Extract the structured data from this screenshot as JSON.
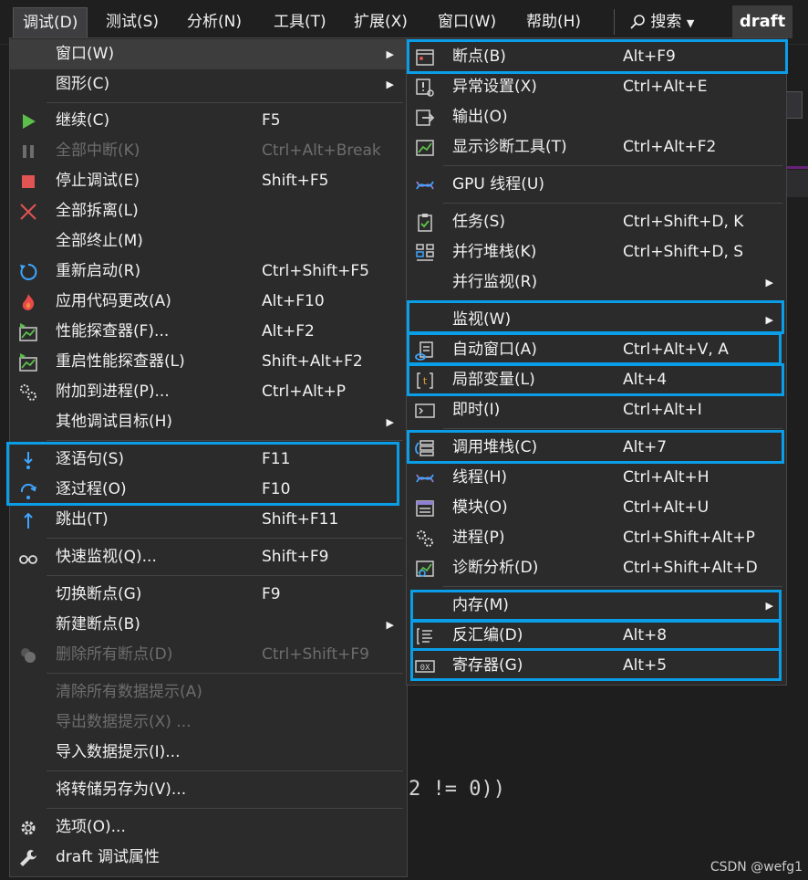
{
  "menubar": {
    "items": [
      "调试(D)",
      "测试(S)",
      "分析(N)",
      "工具(T)",
      "扩展(X)",
      "窗口(W)",
      "帮助(H)"
    ],
    "search_label": "搜索",
    "project_badge": "draft"
  },
  "background": {
    "code_text": "2 != 0))",
    "watermark": "CSDN @wefg1"
  },
  "debug_menu": {
    "items": [
      {
        "label": "窗口(W)",
        "shortcut": ""
      },
      {
        "label": "图形(C)",
        "shortcut": ""
      },
      {
        "label": "继续(C)",
        "shortcut": "F5"
      },
      {
        "label": "全部中断(K)",
        "shortcut": "Ctrl+Alt+Break"
      },
      {
        "label": "停止调试(E)",
        "shortcut": "Shift+F5"
      },
      {
        "label": "全部拆离(L)",
        "shortcut": ""
      },
      {
        "label": "全部终止(M)",
        "shortcut": ""
      },
      {
        "label": "重新启动(R)",
        "shortcut": "Ctrl+Shift+F5"
      },
      {
        "label": "应用代码更改(A)",
        "shortcut": "Alt+F10"
      },
      {
        "label": "性能探查器(F)...",
        "shortcut": "Alt+F2"
      },
      {
        "label": "重启性能探查器(L)",
        "shortcut": "Shift+Alt+F2"
      },
      {
        "label": "附加到进程(P)...",
        "shortcut": "Ctrl+Alt+P"
      },
      {
        "label": "其他调试目标(H)",
        "shortcut": ""
      },
      {
        "label": "逐语句(S)",
        "shortcut": "F11"
      },
      {
        "label": "逐过程(O)",
        "shortcut": "F10"
      },
      {
        "label": "跳出(T)",
        "shortcut": "Shift+F11"
      },
      {
        "label": "快速监视(Q)...",
        "shortcut": "Shift+F9"
      },
      {
        "label": "切换断点(G)",
        "shortcut": "F9"
      },
      {
        "label": "新建断点(B)",
        "shortcut": ""
      },
      {
        "label": "删除所有断点(D)",
        "shortcut": "Ctrl+Shift+F9"
      },
      {
        "label": "清除所有数据提示(A)",
        "shortcut": ""
      },
      {
        "label": "导出数据提示(X) ...",
        "shortcut": ""
      },
      {
        "label": "导入数据提示(I)...",
        "shortcut": ""
      },
      {
        "label": "将转储另存为(V)...",
        "shortcut": ""
      },
      {
        "label": "选项(O)...",
        "shortcut": ""
      },
      {
        "label": "draft 调试属性",
        "shortcut": ""
      }
    ]
  },
  "window_submenu": {
    "items": [
      {
        "label": "断点(B)",
        "shortcut": "Alt+F9"
      },
      {
        "label": "异常设置(X)",
        "shortcut": "Ctrl+Alt+E"
      },
      {
        "label": "输出(O)",
        "shortcut": ""
      },
      {
        "label": "显示诊断工具(T)",
        "shortcut": "Ctrl+Alt+F2"
      },
      {
        "label": "GPU 线程(U)",
        "shortcut": ""
      },
      {
        "label": "任务(S)",
        "shortcut": "Ctrl+Shift+D, K"
      },
      {
        "label": "并行堆栈(K)",
        "shortcut": "Ctrl+Shift+D, S"
      },
      {
        "label": "并行监视(R)",
        "shortcut": ""
      },
      {
        "label": "监视(W)",
        "shortcut": ""
      },
      {
        "label": "自动窗口(A)",
        "shortcut": "Ctrl+Alt+V, A"
      },
      {
        "label": "局部变量(L)",
        "shortcut": "Alt+4"
      },
      {
        "label": "即时(I)",
        "shortcut": "Ctrl+Alt+I"
      },
      {
        "label": "调用堆栈(C)",
        "shortcut": "Alt+7"
      },
      {
        "label": "线程(H)",
        "shortcut": "Ctrl+Alt+H"
      },
      {
        "label": "模块(O)",
        "shortcut": "Ctrl+Alt+U"
      },
      {
        "label": "进程(P)",
        "shortcut": "Ctrl+Shift+Alt+P"
      },
      {
        "label": "诊断分析(D)",
        "shortcut": "Ctrl+Shift+Alt+D"
      },
      {
        "label": "内存(M)",
        "shortcut": ""
      },
      {
        "label": "反汇编(D)",
        "shortcut": "Alt+8"
      },
      {
        "label": "寄存器(G)",
        "shortcut": "Alt+5"
      }
    ]
  },
  "colors": {
    "highlight_border": "#0a9ee8",
    "menu_bg": "#2b2b2b",
    "continue_green": "#5bbd4a",
    "stop_red": "#e05454"
  }
}
